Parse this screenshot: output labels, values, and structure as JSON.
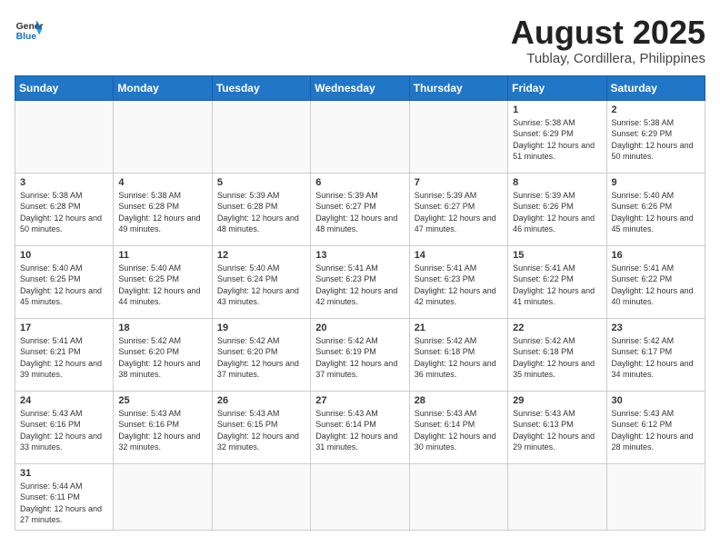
{
  "header": {
    "logo_general": "General",
    "logo_blue": "Blue",
    "title": "August 2025",
    "subtitle": "Tublay, Cordillera, Philippines"
  },
  "weekdays": [
    "Sunday",
    "Monday",
    "Tuesday",
    "Wednesday",
    "Thursday",
    "Friday",
    "Saturday"
  ],
  "weeks": [
    [
      {
        "day": "",
        "info": ""
      },
      {
        "day": "",
        "info": ""
      },
      {
        "day": "",
        "info": ""
      },
      {
        "day": "",
        "info": ""
      },
      {
        "day": "",
        "info": ""
      },
      {
        "day": "1",
        "info": "Sunrise: 5:38 AM\nSunset: 6:29 PM\nDaylight: 12 hours\nand 51 minutes."
      },
      {
        "day": "2",
        "info": "Sunrise: 5:38 AM\nSunset: 6:29 PM\nDaylight: 12 hours\nand 50 minutes."
      }
    ],
    [
      {
        "day": "3",
        "info": "Sunrise: 5:38 AM\nSunset: 6:28 PM\nDaylight: 12 hours\nand 50 minutes."
      },
      {
        "day": "4",
        "info": "Sunrise: 5:38 AM\nSunset: 6:28 PM\nDaylight: 12 hours\nand 49 minutes."
      },
      {
        "day": "5",
        "info": "Sunrise: 5:39 AM\nSunset: 6:28 PM\nDaylight: 12 hours\nand 48 minutes."
      },
      {
        "day": "6",
        "info": "Sunrise: 5:39 AM\nSunset: 6:27 PM\nDaylight: 12 hours\nand 48 minutes."
      },
      {
        "day": "7",
        "info": "Sunrise: 5:39 AM\nSunset: 6:27 PM\nDaylight: 12 hours\nand 47 minutes."
      },
      {
        "day": "8",
        "info": "Sunrise: 5:39 AM\nSunset: 6:26 PM\nDaylight: 12 hours\nand 46 minutes."
      },
      {
        "day": "9",
        "info": "Sunrise: 5:40 AM\nSunset: 6:26 PM\nDaylight: 12 hours\nand 45 minutes."
      }
    ],
    [
      {
        "day": "10",
        "info": "Sunrise: 5:40 AM\nSunset: 6:25 PM\nDaylight: 12 hours\nand 45 minutes."
      },
      {
        "day": "11",
        "info": "Sunrise: 5:40 AM\nSunset: 6:25 PM\nDaylight: 12 hours\nand 44 minutes."
      },
      {
        "day": "12",
        "info": "Sunrise: 5:40 AM\nSunset: 6:24 PM\nDaylight: 12 hours\nand 43 minutes."
      },
      {
        "day": "13",
        "info": "Sunrise: 5:41 AM\nSunset: 6:23 PM\nDaylight: 12 hours\nand 42 minutes."
      },
      {
        "day": "14",
        "info": "Sunrise: 5:41 AM\nSunset: 6:23 PM\nDaylight: 12 hours\nand 42 minutes."
      },
      {
        "day": "15",
        "info": "Sunrise: 5:41 AM\nSunset: 6:22 PM\nDaylight: 12 hours\nand 41 minutes."
      },
      {
        "day": "16",
        "info": "Sunrise: 5:41 AM\nSunset: 6:22 PM\nDaylight: 12 hours\nand 40 minutes."
      }
    ],
    [
      {
        "day": "17",
        "info": "Sunrise: 5:41 AM\nSunset: 6:21 PM\nDaylight: 12 hours\nand 39 minutes."
      },
      {
        "day": "18",
        "info": "Sunrise: 5:42 AM\nSunset: 6:20 PM\nDaylight: 12 hours\nand 38 minutes."
      },
      {
        "day": "19",
        "info": "Sunrise: 5:42 AM\nSunset: 6:20 PM\nDaylight: 12 hours\nand 37 minutes."
      },
      {
        "day": "20",
        "info": "Sunrise: 5:42 AM\nSunset: 6:19 PM\nDaylight: 12 hours\nand 37 minutes."
      },
      {
        "day": "21",
        "info": "Sunrise: 5:42 AM\nSunset: 6:18 PM\nDaylight: 12 hours\nand 36 minutes."
      },
      {
        "day": "22",
        "info": "Sunrise: 5:42 AM\nSunset: 6:18 PM\nDaylight: 12 hours\nand 35 minutes."
      },
      {
        "day": "23",
        "info": "Sunrise: 5:42 AM\nSunset: 6:17 PM\nDaylight: 12 hours\nand 34 minutes."
      }
    ],
    [
      {
        "day": "24",
        "info": "Sunrise: 5:43 AM\nSunset: 6:16 PM\nDaylight: 12 hours\nand 33 minutes."
      },
      {
        "day": "25",
        "info": "Sunrise: 5:43 AM\nSunset: 6:16 PM\nDaylight: 12 hours\nand 32 minutes."
      },
      {
        "day": "26",
        "info": "Sunrise: 5:43 AM\nSunset: 6:15 PM\nDaylight: 12 hours\nand 32 minutes."
      },
      {
        "day": "27",
        "info": "Sunrise: 5:43 AM\nSunset: 6:14 PM\nDaylight: 12 hours\nand 31 minutes."
      },
      {
        "day": "28",
        "info": "Sunrise: 5:43 AM\nSunset: 6:14 PM\nDaylight: 12 hours\nand 30 minutes."
      },
      {
        "day": "29",
        "info": "Sunrise: 5:43 AM\nSunset: 6:13 PM\nDaylight: 12 hours\nand 29 minutes."
      },
      {
        "day": "30",
        "info": "Sunrise: 5:43 AM\nSunset: 6:12 PM\nDaylight: 12 hours\nand 28 minutes."
      }
    ],
    [
      {
        "day": "31",
        "info": "Sunrise: 5:44 AM\nSunset: 6:11 PM\nDaylight: 12 hours\nand 27 minutes."
      },
      {
        "day": "",
        "info": ""
      },
      {
        "day": "",
        "info": ""
      },
      {
        "day": "",
        "info": ""
      },
      {
        "day": "",
        "info": ""
      },
      {
        "day": "",
        "info": ""
      },
      {
        "day": "",
        "info": ""
      }
    ]
  ]
}
